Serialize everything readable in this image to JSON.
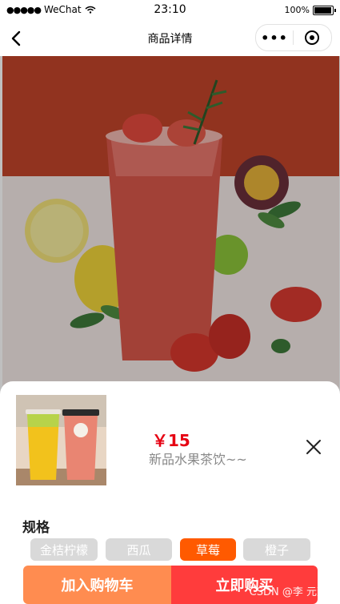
{
  "status_bar": {
    "carrier": "WeChat",
    "time": "23:10",
    "battery": "100%"
  },
  "nav": {
    "title": "商品详情",
    "more_label": "•••"
  },
  "product": {
    "price": "￥15",
    "name": "新品水果茶饮~~"
  },
  "spec": {
    "title": "规格",
    "options": [
      "金桔柠檬",
      "西瓜",
      "草莓",
      "橙子"
    ],
    "selected": "草莓"
  },
  "actions": {
    "add_to_cart": "加入购物车",
    "buy_now": "立即购买"
  },
  "watermark": "CSDN @李 元芳",
  "colors": {
    "price": "#e60012",
    "selected_chip": "#ff5a00",
    "cart_button": "#ff8c50",
    "buy_button": "#ff3c3c"
  }
}
